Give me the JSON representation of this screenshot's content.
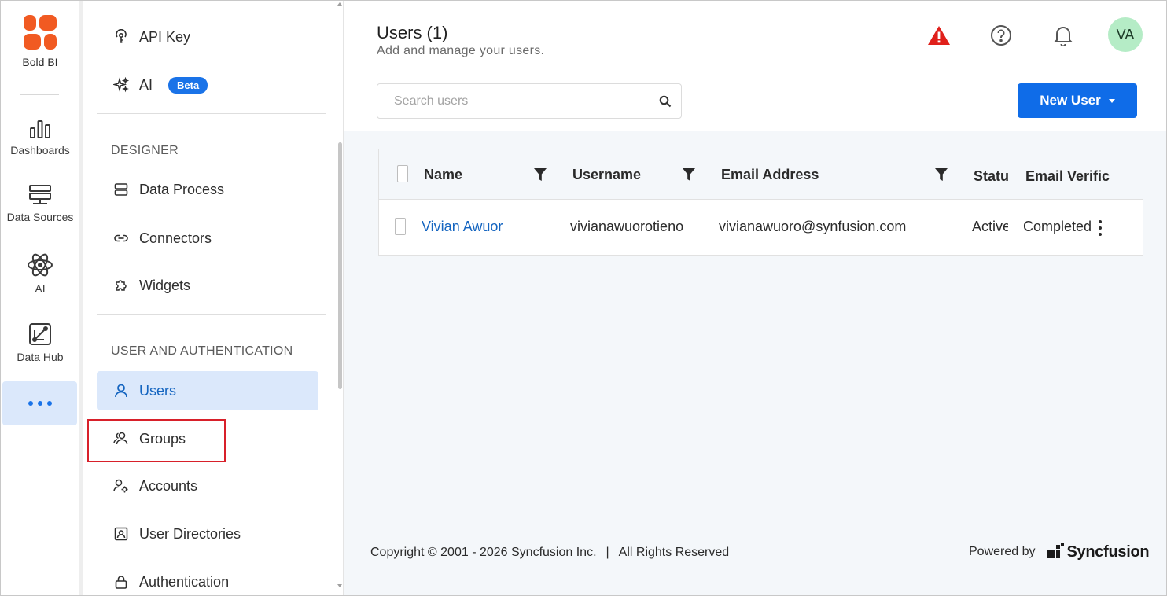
{
  "app": {
    "brand": "Bold BI",
    "colors": {
      "accent": "#0f6ce8",
      "active_bg": "#dbe8fb",
      "highlight": "#d8202a",
      "logo": "#f15a22",
      "warning": "#e0201b"
    }
  },
  "rail": {
    "items": [
      {
        "label": "Dashboards",
        "icon": "bar-chart-icon"
      },
      {
        "label": "Data Sources",
        "icon": "database-icon"
      },
      {
        "label": "AI",
        "icon": "atom-icon"
      },
      {
        "label": "Data Hub",
        "icon": "data-hub-icon"
      }
    ],
    "more_icon": "more-horizontal-icon"
  },
  "panel": {
    "top_items": [
      {
        "label": "API Key",
        "icon": "api-key-icon"
      },
      {
        "label": "AI",
        "icon": "sparkle-icon",
        "badge": "Beta"
      }
    ],
    "designer": {
      "heading": "DESIGNER",
      "items": [
        {
          "label": "Data Process",
          "icon": "data-process-icon"
        },
        {
          "label": "Connectors",
          "icon": "link-icon"
        },
        {
          "label": "Widgets",
          "icon": "puzzle-icon"
        }
      ]
    },
    "user_auth": {
      "heading": "USER AND AUTHENTICATION",
      "items": [
        {
          "label": "Users",
          "icon": "user-icon",
          "active": true
        },
        {
          "label": "Groups",
          "icon": "group-icon",
          "highlighted": true
        },
        {
          "label": "Accounts",
          "icon": "user-gear-icon"
        },
        {
          "label": "User Directories",
          "icon": "directory-icon"
        },
        {
          "label": "Authentication",
          "icon": "lock-icon"
        }
      ]
    }
  },
  "header": {
    "title": "Users (1)",
    "subtitle": "Add and manage your users.",
    "icons": [
      "warning-icon",
      "help-icon",
      "bell-icon"
    ],
    "avatar": "VA"
  },
  "toolbar": {
    "search_placeholder": "Search users",
    "new_user_label": "New User"
  },
  "grid": {
    "columns": [
      "Name",
      "Username",
      "Email Address",
      "Statu",
      "Email Verific"
    ],
    "rows": [
      {
        "name": "Vivian Awuor",
        "username": "vivianawuorotieno",
        "email": "vivianawuoro@synfusion.com",
        "status": "Active",
        "verification": "Completed"
      }
    ]
  },
  "footer": {
    "copyright": "Copyright © 2001 - 2026 Syncfusion Inc.",
    "separator": "|",
    "rights": "All Rights Reserved",
    "powered_by": "Powered by",
    "logo_text": "Syncfusion"
  }
}
